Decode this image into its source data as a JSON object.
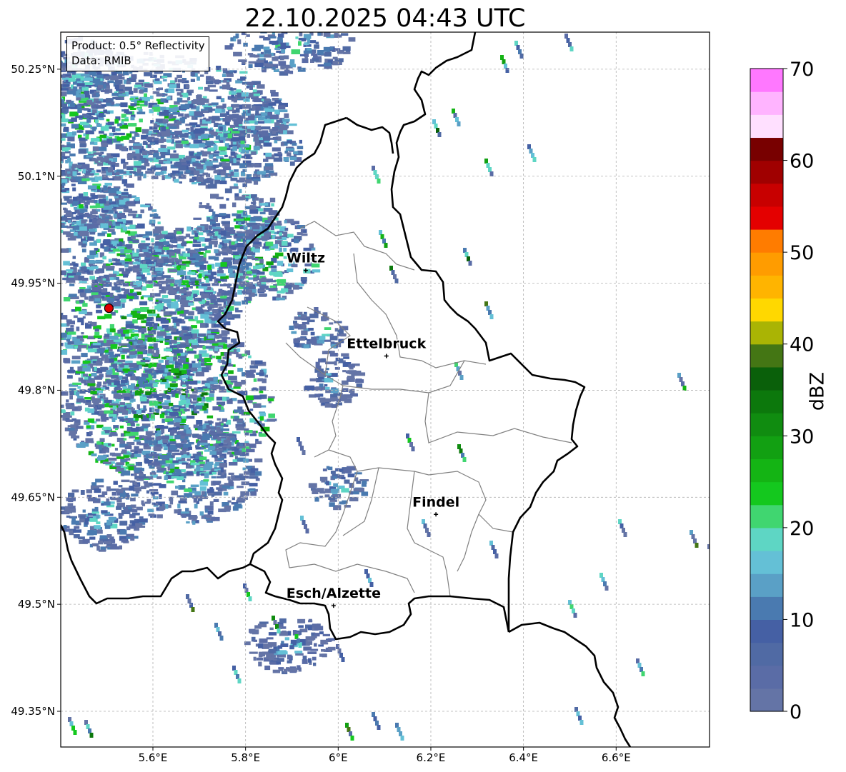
{
  "title": "22.10.2025 04:43 UTC",
  "info": {
    "product": "Product: 0.5° Reflectivity",
    "data_source": "Data: RMIB"
  },
  "map": {
    "lon_range": [
      5.4,
      6.8
    ],
    "lat_range": [
      49.3,
      50.3
    ],
    "lon_ticks": [
      {
        "value": 5.6,
        "label": "5.6°E"
      },
      {
        "value": 5.8,
        "label": "5.8°E"
      },
      {
        "value": 6.0,
        "label": "6°E"
      },
      {
        "value": 6.2,
        "label": "6.2°E"
      },
      {
        "value": 6.4,
        "label": "6.4°E"
      },
      {
        "value": 6.6,
        "label": "6.6°E"
      }
    ],
    "lat_ticks": [
      {
        "value": 50.25,
        "label": "50.25°N"
      },
      {
        "value": 50.1,
        "label": "50.1°N"
      },
      {
        "value": 49.95,
        "label": "49.95°N"
      },
      {
        "value": 49.8,
        "label": "49.8°N"
      },
      {
        "value": 49.65,
        "label": "49.65°N"
      },
      {
        "value": 49.5,
        "label": "49.5°N"
      },
      {
        "value": 49.35,
        "label": "49.35°N"
      }
    ],
    "grid": true,
    "cities": [
      {
        "name": "Wiltz",
        "lon": 5.93,
        "lat": 49.968
      },
      {
        "name": "Ettelbruck",
        "lon": 6.104,
        "lat": 49.848
      },
      {
        "name": "Findel",
        "lon": 6.211,
        "lat": 49.626
      },
      {
        "name": "Esch/Alzette",
        "lon": 5.99,
        "lat": 49.498
      }
    ],
    "radar_site": {
      "lon": 5.505,
      "lat": 49.915,
      "color": "#e00000"
    },
    "colors": {
      "border": "#000000",
      "cantons": "#808080",
      "grid": "#b0b0b0"
    }
  },
  "colorbar": {
    "label": "dBZ",
    "min": 0,
    "max": 70,
    "step": 2.5,
    "tick_labels": [
      "0",
      "10",
      "20",
      "30",
      "40",
      "50",
      "60",
      "70"
    ],
    "colors": [
      "#6474a6",
      "#5a6ca6",
      "#506aa4",
      "#4560a4",
      "#4a7ab0",
      "#5aa0c6",
      "#64c0d6",
      "#5ed6c4",
      "#40d670",
      "#14c81e",
      "#14b414",
      "#12a012",
      "#108c10",
      "#0c780c",
      "#0a600a",
      "#447614",
      "#aab404",
      "#ffd800",
      "#ffb400",
      "#ff9c00",
      "#ff7c00",
      "#e40000",
      "#c80000",
      "#a00000",
      "#780000",
      "#ffe0ff",
      "#ffb4ff",
      "#ff78ff",
      "#ec3cec"
    ]
  }
}
